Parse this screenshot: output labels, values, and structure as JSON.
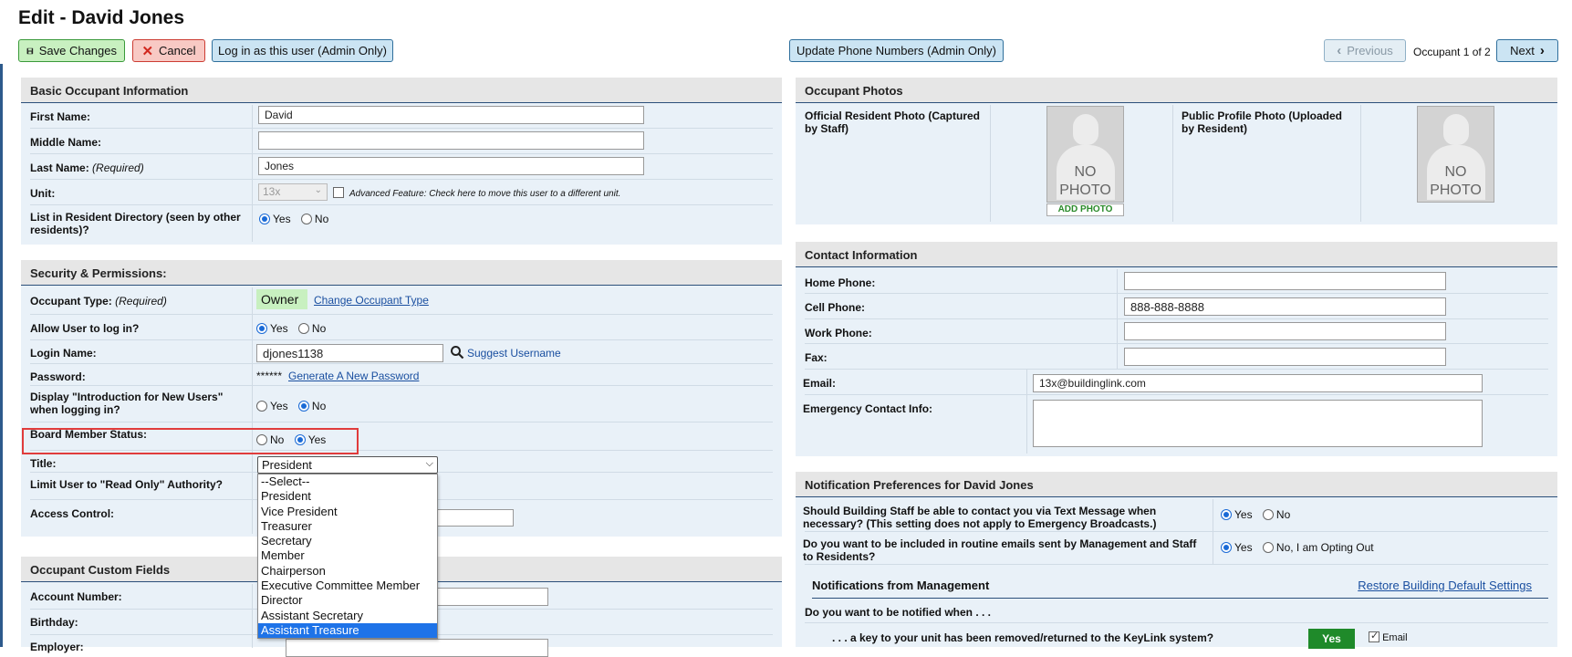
{
  "page": {
    "title": "Edit - David Jones"
  },
  "toolbar": {
    "save": "Save Changes",
    "cancel": "Cancel",
    "login_as": "Log in as this user (Admin Only)",
    "update_phones": "Update Phone Numbers (Admin Only)",
    "previous": "Previous",
    "occupant_counter": "Occupant 1 of 2",
    "next": "Next"
  },
  "basic": {
    "heading": "Basic Occupant Information",
    "first_name_label": "First Name:",
    "first_name": "David",
    "middle_name_label": "Middle Name:",
    "middle_name": "",
    "last_name_label": "Last Name:",
    "last_name_req": "(Required)",
    "last_name": "Jones",
    "unit_label": "Unit:",
    "unit_value": "13x",
    "unit_note": "Advanced Feature: Check here to move this user to a different unit.",
    "directory_label": "List in Resident Directory (seen by other residents)?",
    "yes": "Yes",
    "no": "No"
  },
  "security": {
    "heading": "Security & Permissions:",
    "occupant_type_label": "Occupant Type:",
    "required": "(Required)",
    "occupant_type": "Owner",
    "change_type": "Change Occupant Type",
    "allow_login_label": "Allow User to log in?",
    "login_name_label": "Login Name:",
    "login_name": "djones1138",
    "suggest_username": "Suggest Username",
    "password_label": "Password:",
    "password_mask": "******",
    "generate_password": "Generate A New Password",
    "intro_label": "Display \"Introduction for New Users\" when logging in?",
    "board_label": "Board Member Status:",
    "title_label": "Title:",
    "title_value": "President",
    "read_only_label": "Limit User to \"Read Only\" Authority?",
    "access_label": "Access Control:",
    "yes": "Yes",
    "no": "No"
  },
  "title_options": [
    "--Select--",
    "President",
    "Vice President",
    "Treasurer",
    "Secretary",
    "Member",
    "Chairperson",
    "Executive Committee Member",
    "Director",
    "Assistant Secretary",
    "Assistant Treasure"
  ],
  "custom": {
    "heading": "Occupant Custom Fields",
    "account_label": "Account Number:",
    "birthday_label": "Birthday:",
    "employer_label": "Employer:"
  },
  "photos": {
    "heading": "Occupant Photos",
    "official_label": "Official Resident Photo (Captured by Staff)",
    "public_label": "Public Profile Photo (Uploaded by Resident)",
    "no_photo": "NO PHOTO",
    "add_photo": "ADD PHOTO"
  },
  "contact": {
    "heading": "Contact Information",
    "home_label": "Home Phone:",
    "home": "",
    "cell_label": "Cell Phone:",
    "cell": "888-888-8888",
    "work_label": "Work Phone:",
    "work": "",
    "fax_label": "Fax:",
    "fax": "",
    "email_label": "Email:",
    "email": "13x@buildinglink.com",
    "emergency_label": "Emergency Contact Info:"
  },
  "notifications": {
    "heading": "Notification Preferences for David Jones",
    "text_msg_q": "Should Building Staff be able to contact you via Text Message when necessary? (This setting does not apply to Emergency Broadcasts.)",
    "routine_q": "Do you want to be included in routine emails sent by Management and Staff to Residents?",
    "yes": "Yes",
    "no": "No",
    "opt_out": "No, I am Opting Out",
    "from_mgmt": "Notifications from Management",
    "restore": "Restore Building Default Settings",
    "notified_when": "Do you want to be notified when . . .",
    "key_q": ". . . a key to your unit has been removed/returned to the KeyLink system?",
    "key_yes": "Yes",
    "email_label": "Email"
  },
  "colors": {
    "panel_bg": "#e9f1f8",
    "header_bg": "#e6e6e6",
    "accent": "#2b4f7a",
    "owner_badge": "#c8f0c0",
    "yes_green": "#1f8a2a",
    "highlight": "#e03c3c"
  }
}
